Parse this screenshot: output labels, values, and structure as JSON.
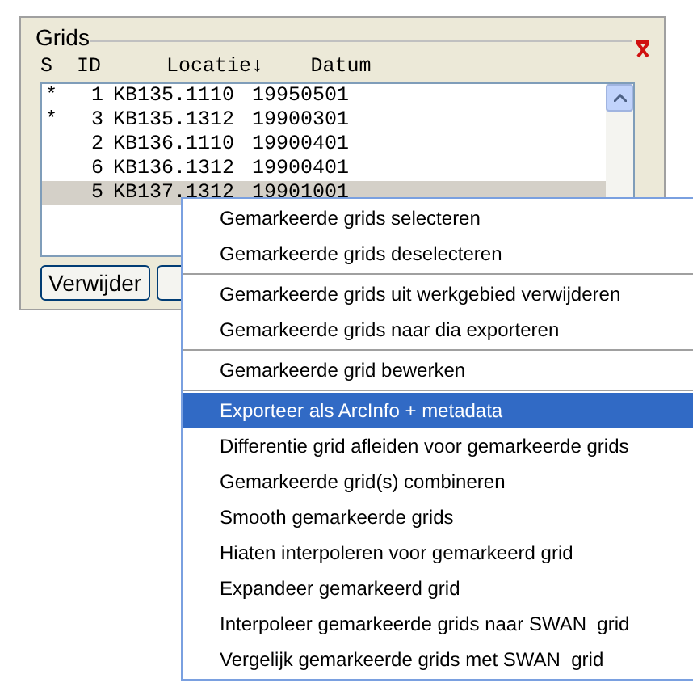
{
  "group": {
    "title": "Grids"
  },
  "columns": [
    "S",
    "ID",
    "Locatie↓",
    "Datum"
  ],
  "rows": [
    {
      "s": "*",
      "id": "1",
      "locatie": "KB135.1110",
      "datum": "19950501",
      "selected": false
    },
    {
      "s": "*",
      "id": "3",
      "locatie": "KB135.1312",
      "datum": "19900301",
      "selected": false
    },
    {
      "s": "",
      "id": "2",
      "locatie": "KB136.1110",
      "datum": "19900401",
      "selected": false
    },
    {
      "s": "",
      "id": "6",
      "locatie": "KB136.1312",
      "datum": "19900401",
      "selected": false
    },
    {
      "s": "",
      "id": "5",
      "locatie": "KB137.1312",
      "datum": "19901001",
      "selected": true
    }
  ],
  "buttons": [
    "Verwijder"
  ],
  "context_menu": [
    {
      "label": "Gemarkeerde grids selecteren",
      "selected": false,
      "separator_after": false
    },
    {
      "label": "Gemarkeerde grids deselecteren",
      "selected": false,
      "separator_after": true
    },
    {
      "label": "Gemarkeerde grids uit werkgebied verwijderen",
      "selected": false,
      "separator_after": false
    },
    {
      "label": "Gemarkeerde grids naar dia exporteren",
      "selected": false,
      "separator_after": true
    },
    {
      "label": "Gemarkeerde grid bewerken",
      "selected": false,
      "separator_after": true
    },
    {
      "label": "Exporteer als ArcInfo + metadata",
      "selected": true,
      "separator_after": false
    },
    {
      "label": "Differentie grid afleiden voor gemarkeerde grids",
      "selected": false,
      "separator_after": false
    },
    {
      "label": "Gemarkeerde grid(s) combineren",
      "selected": false,
      "separator_after": false
    },
    {
      "label": "Smooth gemarkeerde grids",
      "selected": false,
      "separator_after": false
    },
    {
      "label": "Hiaten interpoleren voor gemarkeerd grid",
      "selected": false,
      "separator_after": false
    },
    {
      "label": "Expandeer gemarkeerd grid",
      "selected": false,
      "separator_after": false
    },
    {
      "label": "Interpoleer gemarkeerde grids naar SWAN  grid",
      "selected": false,
      "separator_after": false
    },
    {
      "label": "Vergelijk gemarkeerde grids met SWAN  grid",
      "selected": false,
      "separator_after": false
    }
  ]
}
